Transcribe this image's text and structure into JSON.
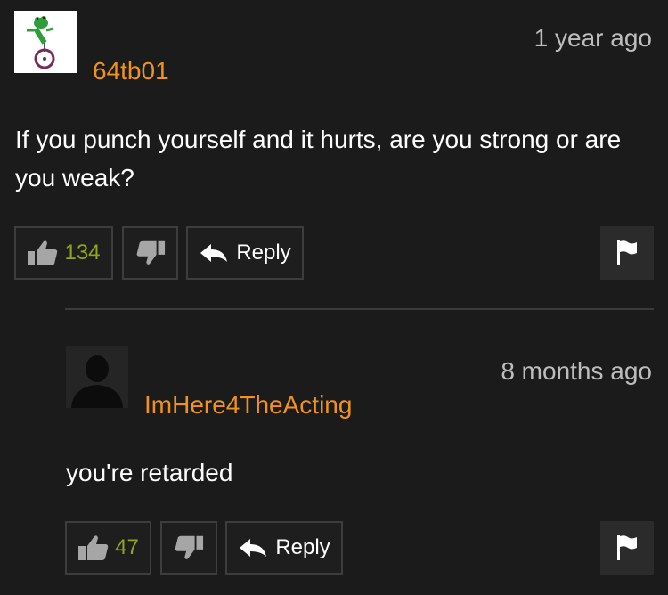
{
  "comments": [
    {
      "username": "64tb01",
      "timestamp": "1 year ago",
      "text": "If you punch yourself and it hurts, are you strong or are you weak?",
      "likes": "134",
      "reply_label": "Reply",
      "avatar_icon": "frog-unicycle-avatar"
    },
    {
      "username": "ImHere4TheActing",
      "timestamp": "8 months ago",
      "text": "you're retarded",
      "likes": "47",
      "reply_label": "Reply",
      "avatar_icon": "default-user-avatar"
    }
  ],
  "colors": {
    "background": "#1b1b1b",
    "username": "#f0921e",
    "like_count": "#8ea51e",
    "timestamp": "#bdbdbd"
  }
}
